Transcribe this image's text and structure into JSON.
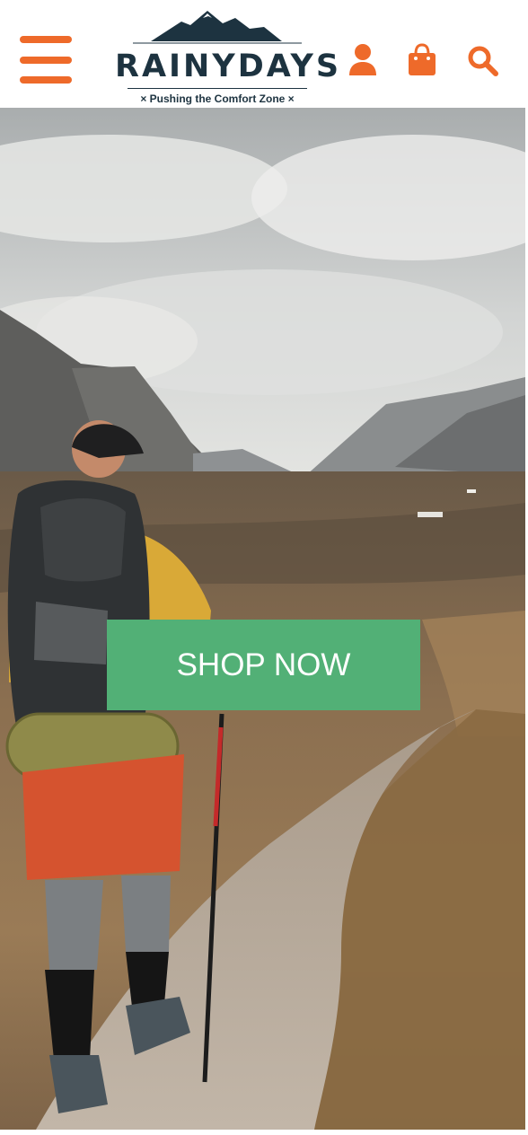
{
  "header": {
    "brand_name": "RAINYDAYS",
    "tagline": "× Pushing the Comfort Zone ×",
    "icons": [
      "hamburger-menu-icon",
      "user-account-icon",
      "shopping-bag-icon",
      "search-icon"
    ],
    "accent_color": "#ee6a2a",
    "brand_color": "#1d3340"
  },
  "hero": {
    "cta_label": "SHOP NOW",
    "cta_color": "#52b076"
  }
}
